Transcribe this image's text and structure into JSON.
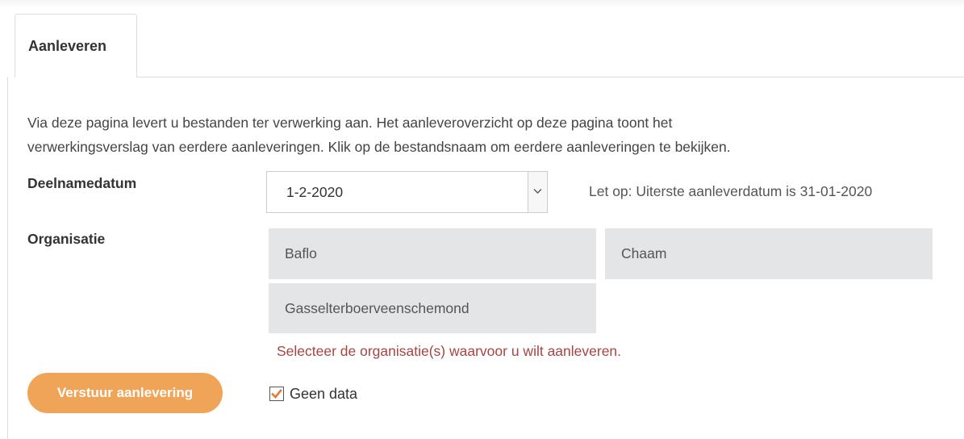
{
  "tabs": [
    {
      "label": "Aanleveren",
      "active": true
    }
  ],
  "intro": {
    "line1": "Via deze pagina levert u bestanden ter verwerking aan. Het aanleveroverzicht op deze pagina toont het",
    "line2": "verwerkingsverslag van eerdere aanleveringen. Klik op de bestandsnaam om eerdere aanleveringen te bekijken."
  },
  "form": {
    "date_label": "Deelnamedatum",
    "date_value": "1-2-2020",
    "date_note": "Let op: Uiterste aanleverdatum is 31-01-2020",
    "org_label": "Organisatie",
    "organisations": [
      "Baflo",
      "Chaam",
      "Gasselterboerveenschemond"
    ],
    "org_error": "Selecteer de organisatie(s) waarvoor u wilt aanleveren.",
    "submit_label": "Verstuur aanlevering",
    "no_data_label": "Geen data",
    "no_data_checked": true
  },
  "colors": {
    "accent": "#f0a458",
    "error": "#a94442",
    "org_bg": "#e4e5e6",
    "checkmark": "#e8772e"
  },
  "icons": {
    "select_arrow": "chevron-down-icon",
    "checkbox": "checkmark-icon"
  }
}
